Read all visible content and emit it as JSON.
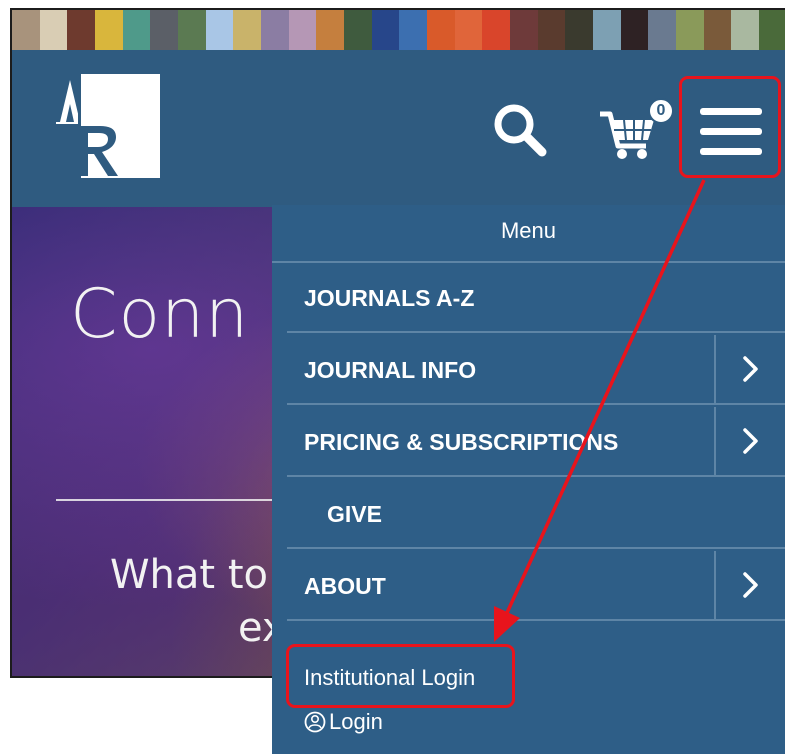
{
  "header": {
    "logo_text": "AR",
    "cart_count": "0"
  },
  "hero": {
    "title_partial": "Conn",
    "subtitle_line1_partial": "What to",
    "subtitle_line2_partial": "ex"
  },
  "menu": {
    "title": "Menu",
    "items": [
      {
        "label": "JOURNALS A-Z",
        "has_submenu": false
      },
      {
        "label": "JOURNAL INFO",
        "has_submenu": true
      },
      {
        "label": "PRICING & SUBSCRIPTIONS",
        "has_submenu": true
      },
      {
        "label": "GIVE",
        "has_submenu": false
      },
      {
        "label": "ABOUT",
        "has_submenu": true
      }
    ],
    "institutional_login": "Institutional Login",
    "login": "Login"
  },
  "colors": {
    "header_bg": "#2f5b80",
    "menu_bg": "#2e5e87",
    "highlight": "#e8141c",
    "strip": [
      "#a8937c",
      "#d9cdb4",
      "#6e3a2e",
      "#d9b63c",
      "#4f9a8a",
      "#5b5f67",
      "#5b7a52",
      "#a9c6e6",
      "#c9b36a",
      "#8b7da3",
      "#b597b5",
      "#c57f3e",
      "#3f5b3e",
      "#27468a",
      "#3c6fb0",
      "#d95a2a",
      "#e0653a",
      "#d9452b",
      "#6e3a3a",
      "#5a3b2e",
      "#3a3a2e",
      "#7da0b3",
      "#2e2224",
      "#6a7a90",
      "#8a9a5a",
      "#7a5a3a",
      "#a9b8a0",
      "#4a6a3a"
    ]
  },
  "icons": {
    "search": "search-icon",
    "cart": "cart-icon",
    "menu": "hamburger-menu-icon",
    "chevron": "chevron-right-icon",
    "user": "user-icon"
  }
}
